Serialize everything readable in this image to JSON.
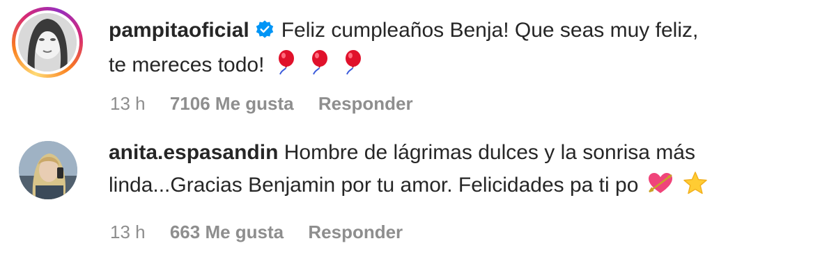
{
  "comments": [
    {
      "username": "pampitaoficial",
      "verified": true,
      "text_line1": "Feliz cumpleaños Benja! Que seas muy feliz,",
      "text_line2": "te mereces todo!",
      "emojis": [
        "balloon-icon",
        "balloon-icon",
        "balloon-icon"
      ],
      "time": "13 h",
      "likes": "7106 Me gusta",
      "reply": "Responder"
    },
    {
      "username": "anita.espasandin",
      "verified": false,
      "text_line1": "Hombre de lágrimas dulces y la sonrisa más",
      "text_line2": "linda...Gracias Benjamin por tu amor. Felicidades pa ti po",
      "emojis": [
        "heart-with-arrow-icon",
        "star-icon"
      ],
      "time": "13 h",
      "likes": "663 Me gusta",
      "reply": "Responder"
    }
  ],
  "colors": {
    "text": "#262626",
    "meta": "#8e8e8e",
    "verified": "#0095f6",
    "balloon": "#e0112b",
    "heart": "#f0447a",
    "star": "#ffcc33"
  }
}
